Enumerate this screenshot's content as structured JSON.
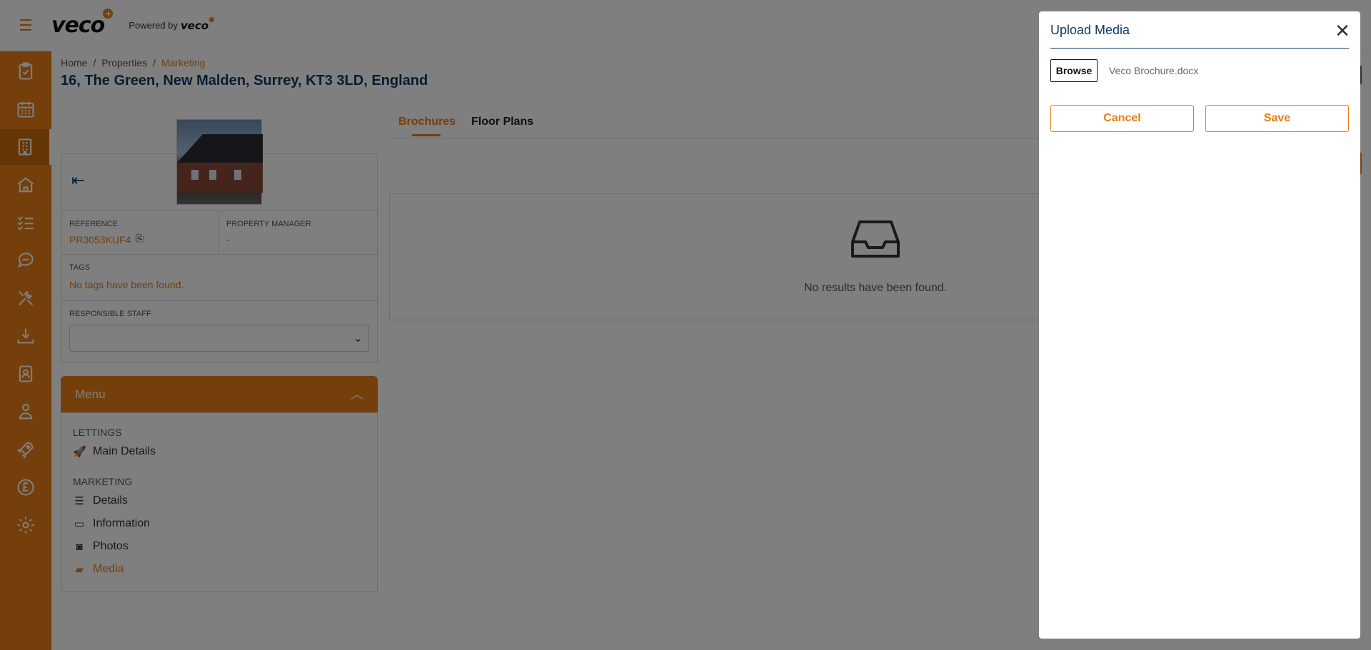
{
  "brand": {
    "logo_text": "veco",
    "powered_by": "Powered by",
    "powered_logo": "veco",
    "accent_color": "#E87E15",
    "title_color": "#0d3b66"
  },
  "sidebar": {
    "items": [
      {
        "icon": "clipboard-check-icon"
      },
      {
        "icon": "calendar-icon"
      },
      {
        "icon": "building-icon",
        "active": true
      },
      {
        "icon": "home-icon"
      },
      {
        "icon": "checklist-icon"
      },
      {
        "icon": "chat-icon"
      },
      {
        "icon": "tools-icon"
      },
      {
        "icon": "download-tray-icon"
      },
      {
        "icon": "contact-book-icon"
      },
      {
        "icon": "person-icon"
      },
      {
        "icon": "rocket-icon"
      },
      {
        "icon": "pound-coin-icon"
      },
      {
        "icon": "gear-icon"
      }
    ]
  },
  "breadcrumb": {
    "home": "Home",
    "sep1": "/",
    "properties": "Properties",
    "sep2": "/",
    "current": "Marketing"
  },
  "page": {
    "title": "16, The Green, New Malden, Surrey, KT3 3LD, England"
  },
  "property": {
    "reference_label": "REFERENCE",
    "reference_value": "PR3053KUF4",
    "manager_label": "PROPERTY MANAGER",
    "manager_value": "-",
    "tags_label": "TAGS",
    "tags_value": "No tags have been found.",
    "staff_label": "RESPONSIBLE STAFF"
  },
  "menu": {
    "title": "Menu",
    "sections": [
      {
        "label": "LETTINGS",
        "items": [
          {
            "label": "Main Details",
            "icon": "rocket-icon"
          }
        ]
      },
      {
        "label": "MARKETING",
        "items": [
          {
            "label": "Details",
            "icon": "list-icon"
          },
          {
            "label": "Information",
            "icon": "card-icon"
          },
          {
            "label": "Photos",
            "icon": "camera-icon"
          },
          {
            "label": "Media",
            "icon": "folder-icon",
            "active": true
          }
        ]
      }
    ]
  },
  "tabs": [
    {
      "label": "Brochures",
      "active": true
    },
    {
      "label": "Floor Plans",
      "active": false
    }
  ],
  "empty_state": {
    "message": "No results have been found."
  },
  "modal": {
    "title": "Upload Media",
    "browse_label": "Browse",
    "file_name": "Veco Brochure.docx",
    "cancel_label": "Cancel",
    "save_label": "Save"
  }
}
